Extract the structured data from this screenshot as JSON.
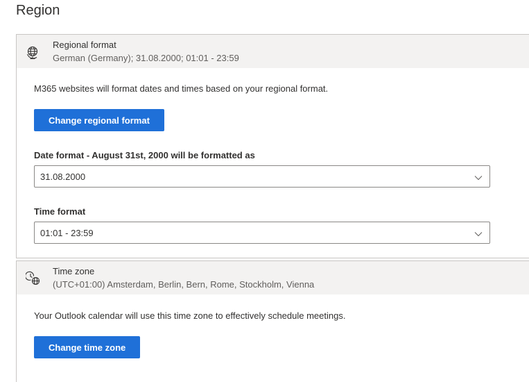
{
  "page": {
    "title": "Region"
  },
  "regional": {
    "header_title": "Regional format",
    "header_subtitle": "German (Germany); 31.08.2000; 01:01 - 23:59",
    "icon": "globe-icon",
    "description": "M365 websites will format dates and times based on your regional format.",
    "change_button_label": "Change regional format",
    "date_format": {
      "label": "Date format - August 31st, 2000 will be formatted as",
      "value": "31.08.2000"
    },
    "time_format": {
      "label": "Time format",
      "value": "01:01 - 23:59"
    }
  },
  "timezone": {
    "header_title": "Time zone",
    "header_subtitle": "(UTC+01:00) Amsterdam, Berlin, Bern, Rome, Stockholm, Vienna",
    "icon": "clock-globe-icon",
    "description": "Your Outlook calendar will use this time zone to effectively schedule meetings.",
    "change_button_label": "Change time zone"
  },
  "colors": {
    "accent": "#1f70d8",
    "header_bg": "#f3f2f1",
    "border": "#c8c6c4"
  }
}
